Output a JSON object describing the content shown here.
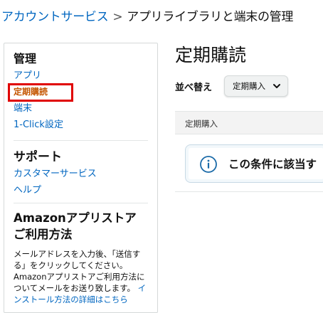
{
  "breadcrumb": {
    "link": "アカウントサービス",
    "separator": ">",
    "current": "アプリライブラリと端末の管理"
  },
  "sidebar": {
    "manage": {
      "title": "管理",
      "items": [
        {
          "label": "アプリ"
        },
        {
          "label": "定期購読",
          "active": true
        },
        {
          "label": "端末"
        },
        {
          "label": "1-Click設定"
        }
      ]
    },
    "support": {
      "title": "サポート",
      "items": [
        {
          "label": "カスタマーサービス"
        },
        {
          "label": "ヘルプ"
        }
      ]
    },
    "appstore": {
      "title_line1": "Amazonアプリストア",
      "title_line2": "ご利用方法",
      "text": "メールアドレスを入力後、「送信する」をクリックしてください。Amazonアプリストアご利用方法についてメールをお送り致します。",
      "link": "インストール方法の詳細はこちら"
    }
  },
  "main": {
    "title": "定期購読",
    "sort": {
      "label": "並べ替え",
      "selected": "定期購入"
    },
    "table_header": "定期購入",
    "alert_text": "この条件に該当す"
  },
  "colors": {
    "link": "#0066c0",
    "active": "#c45500",
    "highlight": "#e00000",
    "info": "#1a6aa8"
  }
}
